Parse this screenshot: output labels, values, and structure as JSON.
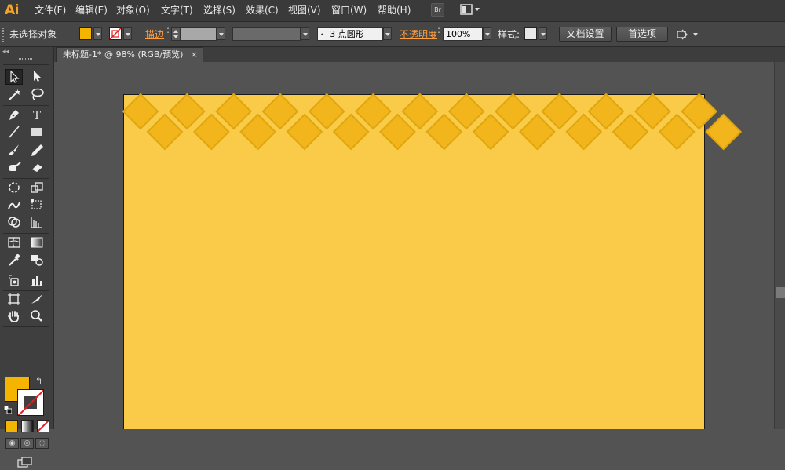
{
  "app": {
    "logo": "Ai"
  },
  "menu": [
    "文件(F)",
    "编辑(E)",
    "对象(O)",
    "文字(T)",
    "选择(S)",
    "效果(C)",
    "视图(V)",
    "窗口(W)",
    "帮助(H)"
  ],
  "menubar_buttons": {
    "bridge": "Br"
  },
  "controlbar": {
    "selection_label": "未选择对象",
    "stroke_link": "描边",
    "brush_value": "3 点圆形",
    "opacity_link": "不透明度",
    "opacity_value": "100%",
    "style_label": "样式:",
    "doc_setup_button": "文档设置",
    "preferences_button": "首选项"
  },
  "document_tab": {
    "title": "未标题-1* @ 98% (RGB/预览)",
    "close": "×"
  },
  "colors": {
    "fill": "#f4b400",
    "artboard": "#f9cb48",
    "diamond": "#f2b51c",
    "diamond_border": "#e0a60e",
    "accent_link": "#ff9e40"
  },
  "tools": [
    "selection-tool",
    "direct-selection-tool",
    "magic-wand-tool",
    "lasso-tool",
    "pen-tool",
    "type-tool",
    "line-segment-tool",
    "rectangle-tool",
    "paintbrush-tool",
    "pencil-tool",
    "blob-brush-tool",
    "eraser-tool",
    "rotate-tool",
    "scale-tool",
    "warp-tool",
    "free-transform-tool",
    "shape-builder-tool",
    "perspective-grid-tool",
    "mesh-tool",
    "gradient-tool",
    "eyedropper-tool",
    "blend-tool",
    "symbol-sprayer-tool",
    "column-graph-tool",
    "artboard-tool",
    "slice-tool",
    "hand-tool",
    "zoom-tool"
  ]
}
